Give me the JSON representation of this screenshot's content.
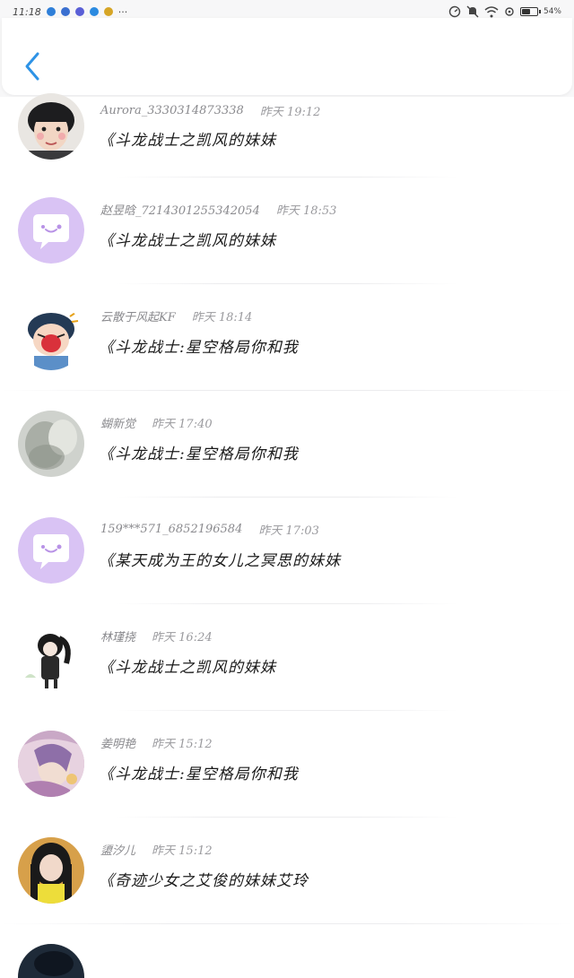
{
  "status_bar": {
    "time": "11:18",
    "more": "···",
    "battery_percent": "54%"
  },
  "nav": {
    "back_icon": "chevron-left-icon",
    "accent": "#2e93e6"
  },
  "items": [
    {
      "user": "Aurora_3330314873338",
      "time": "昨天 19:12",
      "title": "《斗龙战士之凯风的妹妹",
      "avatar": "photo-avatar-boy"
    },
    {
      "user": "赵昱晗_7214301255342054",
      "time": "昨天 18:53",
      "title": "《斗龙战士之凯风的妹妹",
      "avatar": "default-chat-avatar"
    },
    {
      "user": "云散于风起KF",
      "time": "昨天 18:14",
      "title": "《斗龙战士:星空格局你和我",
      "avatar": "cartoon-avatar-crying"
    },
    {
      "user": "蝴新觉",
      "time": "昨天 17:40",
      "title": "《斗龙战士:星空格局你和我",
      "avatar": "photo-avatar-blurred"
    },
    {
      "user": "159***571_6852196584",
      "time": "昨天 17:03",
      "title": "《某天成为王的女儿之冥思的妹妹",
      "avatar": "default-chat-avatar"
    },
    {
      "user": "林瑾挠",
      "time": "昨天 16:24",
      "title": "《斗龙战士之凯风的妹妹",
      "avatar": "cartoon-avatar-girl"
    },
    {
      "user": "姜明艳",
      "time": "昨天 15:12",
      "title": "《斗龙战士:星空格局你和我",
      "avatar": "anime-avatar-purple"
    },
    {
      "user": "盨汐儿",
      "time": "昨天 15:12",
      "title": "《奇迹少女之艾俊的妹妹艾玲",
      "avatar": "photo-avatar-girl"
    },
    {
      "user": "",
      "time": "",
      "title": "",
      "avatar": "photo-avatar-dark"
    }
  ]
}
